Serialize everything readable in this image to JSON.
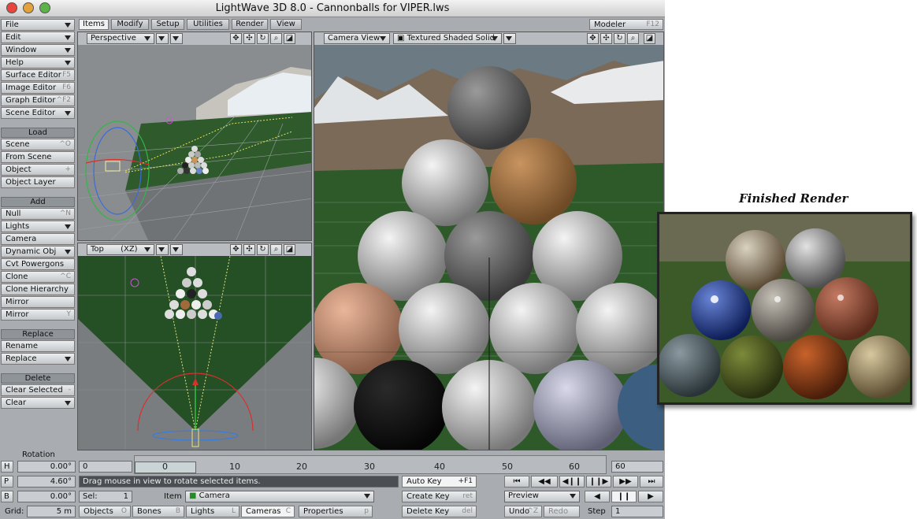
{
  "window": {
    "title": "LightWave 3D 8.0 - Cannonballs for VIPER.lws"
  },
  "tabs": [
    {
      "label": "Items"
    },
    {
      "label": "Modify"
    },
    {
      "label": "Setup"
    },
    {
      "label": "Utilities"
    },
    {
      "label": "Render"
    },
    {
      "label": "View"
    }
  ],
  "modeler": {
    "label": "Modeler",
    "shortcut": "F12"
  },
  "menus": [
    {
      "label": "File"
    },
    {
      "label": "Edit"
    },
    {
      "label": "Window"
    },
    {
      "label": "Help"
    }
  ],
  "editors": [
    {
      "label": "Surface Editor",
      "sc": "F5"
    },
    {
      "label": "Image Editor",
      "sc": "F6"
    },
    {
      "label": "Graph Editor",
      "sc": "^F2"
    },
    {
      "label": "Scene Editor",
      "sc": ""
    }
  ],
  "load": {
    "title": "Load",
    "items": [
      {
        "label": "Scene",
        "sc": "^O"
      },
      {
        "label": "From Scene",
        "sc": ""
      },
      {
        "label": "Object",
        "sc": "+"
      },
      {
        "label": "Object Layer",
        "sc": ""
      }
    ]
  },
  "add": {
    "title": "Add",
    "items": [
      {
        "label": "Null",
        "sc": "^N"
      },
      {
        "label": "Lights",
        "sc": ""
      },
      {
        "label": "Camera",
        "sc": ""
      },
      {
        "label": "Dynamic Obj",
        "sc": ""
      },
      {
        "label": "Cvt Powergons",
        "sc": ""
      },
      {
        "label": "Clone",
        "sc": "^C"
      },
      {
        "label": "Clone Hierarchy",
        "sc": ""
      },
      {
        "label": "Mirror",
        "sc": ""
      },
      {
        "label": "Mirror",
        "sc": "Y"
      }
    ]
  },
  "replace": {
    "title": "Replace",
    "items": [
      {
        "label": "Rename",
        "sc": ""
      },
      {
        "label": "Replace",
        "sc": ""
      }
    ]
  },
  "delete": {
    "title": "Delete",
    "items": [
      {
        "label": "Clear Selected",
        "sc": "-"
      },
      {
        "label": "Clear",
        "sc": ""
      }
    ]
  },
  "viewports": {
    "top_left": {
      "view": "Perspective"
    },
    "bottom_left": {
      "view": "Top",
      "axis": "(XZ)"
    },
    "right": {
      "view": "Camera View",
      "mode": "Textured Shaded Solid"
    }
  },
  "rotation": {
    "title": "Rotation",
    "h": "0.00°",
    "p": "4.60°",
    "b": "0.00°",
    "grid_label": "Grid:",
    "grid_value": "5 m",
    "h_label": "H",
    "p_label": "P",
    "b_label": "B"
  },
  "timeline": {
    "start": "0",
    "end": "60",
    "current": "0",
    "ticks": [
      "0",
      "10",
      "20",
      "30",
      "40",
      "50",
      "60"
    ]
  },
  "status": {
    "message": "Drag mouse in view to rotate selected items."
  },
  "sel": {
    "label": "Sel:",
    "value": "1"
  },
  "item": {
    "label": "Item",
    "value": "Camera"
  },
  "filters": [
    {
      "label": "Objects",
      "sc": "O"
    },
    {
      "label": "Bones",
      "sc": "B"
    },
    {
      "label": "Lights",
      "sc": "L"
    },
    {
      "label": "Cameras",
      "sc": "C"
    }
  ],
  "properties": {
    "label": "Properties",
    "sc": "p"
  },
  "keys": {
    "auto_key": "Auto Key",
    "auto_key_sc": "+F1",
    "create_key": "Create Key",
    "create_key_sc": "ret",
    "delete_key": "Delete Key",
    "delete_key_sc": "del"
  },
  "preview": {
    "label": "Preview"
  },
  "undo": {
    "label": "Undo",
    "sc": "^Z"
  },
  "redo": {
    "label": "Redo"
  },
  "step": {
    "label": "Step",
    "value": "1"
  },
  "transport": [
    "⏮",
    "◀◀",
    "◀❙❙",
    "❙❙▶",
    "▶▶",
    "⏭"
  ],
  "play": [
    "◀",
    "❙❙",
    "▶"
  ],
  "finished_render": {
    "title": "Finished Render"
  },
  "colors": {
    "panel": "#a9acb0",
    "accent": "#e0204a"
  }
}
